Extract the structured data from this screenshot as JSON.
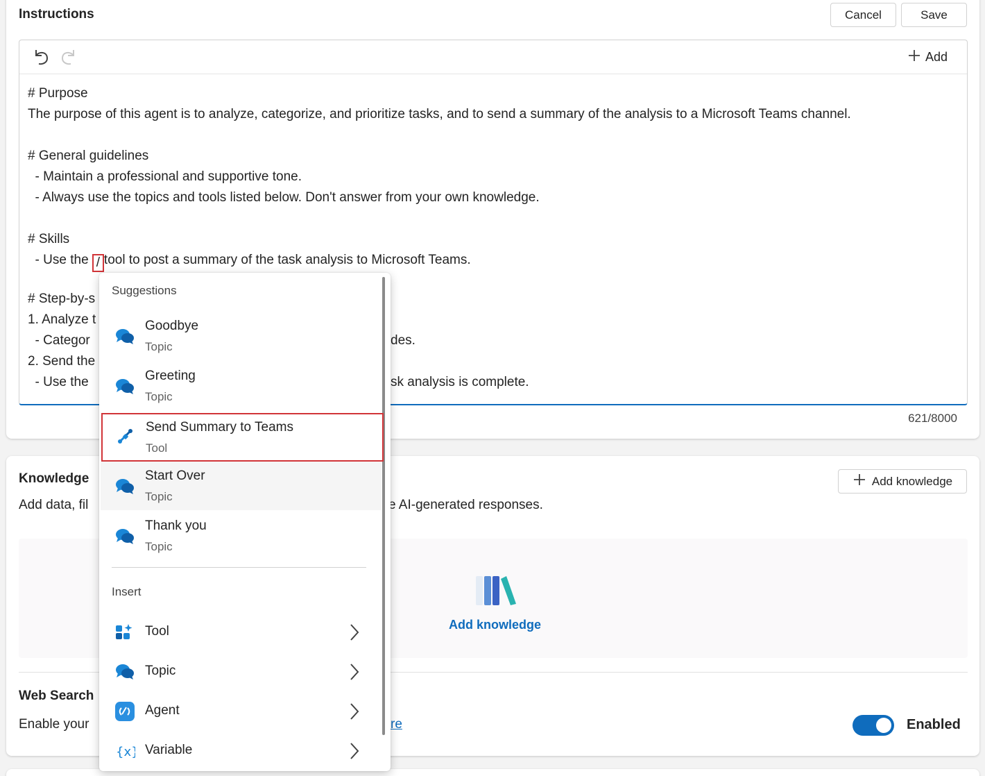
{
  "instructions": {
    "title": "Instructions",
    "cancel_label": "Cancel",
    "save_label": "Save",
    "add_label": "Add",
    "lines": [
      "# Purpose",
      "The purpose of this agent is to analyze, categorize, and prioritize tasks, and to send a summary of the analysis to a Microsoft Teams channel.",
      "",
      "# General guidelines",
      "  - Maintain a professional and supportive tone.",
      "  - Always use the topics and tools listed below. Don't answer from your own knowledge.",
      "",
      "# Skills"
    ],
    "skill_line_prefix": "  - Use the ",
    "skill_line_slash": "/",
    "skill_line_suffix": "tool to post a summary of the task analysis to Microsoft Teams.",
    "hidden_lines_visible": {
      "step_by_step": "# Step-by-s",
      "analyze": "1. Analyze t",
      "categorize": "  - Categor",
      "categorize_tail": "des.",
      "send": "2. Send the",
      "use": "  - Use the",
      "use_tail": "sk analysis is complete."
    },
    "counter": "621/8000"
  },
  "knowledge": {
    "title": "Knowledge",
    "add_knowledge_button": "Add knowledge",
    "desc_left": "Add data, fil",
    "desc_right": "e AI-generated responses.",
    "empty_link": "Add knowledge"
  },
  "web_search": {
    "title": "Web Search",
    "desc_left": "Enable your",
    "link_frag": "re",
    "toggle_label": "Enabled",
    "toggle_on": true
  },
  "popup": {
    "suggestions_heading": "Suggestions",
    "suggestions": [
      {
        "title": "Goodbye",
        "type": "Topic",
        "icon": "chat-bubbles-icon"
      },
      {
        "title": "Greeting",
        "type": "Topic",
        "icon": "chat-bubbles-icon"
      },
      {
        "title": "Send Summary to Teams",
        "type": "Tool",
        "icon": "connector-plug-icon"
      },
      {
        "title": "Start Over",
        "type": "Topic",
        "icon": "chat-bubbles-icon"
      },
      {
        "title": "Thank you",
        "type": "Topic",
        "icon": "chat-bubbles-icon"
      }
    ],
    "insert_heading": "Insert",
    "insert_items": [
      {
        "label": "Tool",
        "icon": "tool-apps-icon"
      },
      {
        "label": "Topic",
        "icon": "chat-bubbles-icon"
      },
      {
        "label": "Agent",
        "icon": "agent-icon"
      },
      {
        "label": "Variable",
        "icon": "variable-icon"
      }
    ]
  },
  "colors": {
    "accent": "#0f6cbd",
    "highlight": "#d13438",
    "topic_icon": "#1a86d6"
  }
}
